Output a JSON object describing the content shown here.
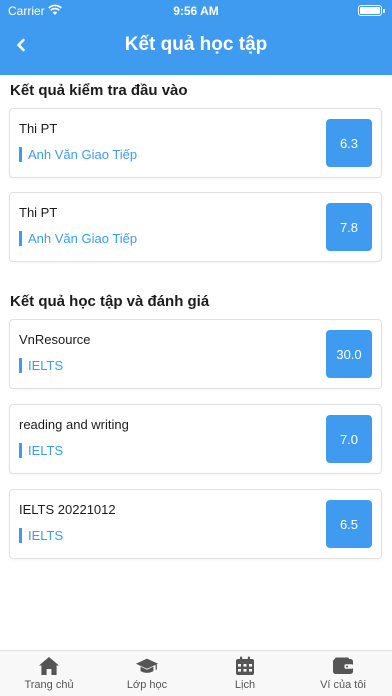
{
  "status_bar": {
    "carrier": "Carrier",
    "time": "9:56 AM"
  },
  "nav": {
    "title": "Kết quả học tập"
  },
  "entrance": {
    "title": "Kết quả kiểm tra đầu vào",
    "items": [
      {
        "title": "Thi PT",
        "subject": "Anh Văn Giao Tiếp",
        "score": "6.3"
      },
      {
        "title": "Thi PT",
        "subject": "Anh Văn Giao Tiếp",
        "score": "7.8"
      }
    ]
  },
  "study": {
    "title": "Kết quả học tập và đánh giá",
    "items": [
      {
        "title": "VnResource",
        "subject": "IELTS",
        "score": "30.0"
      },
      {
        "title": "reading and writing",
        "subject": "IELTS",
        "score": "7.0"
      },
      {
        "title": "IELTS 20221012",
        "subject": "IELTS",
        "score": "6.5"
      }
    ]
  },
  "tabs": [
    {
      "label": "Trang chủ",
      "icon": "home-icon"
    },
    {
      "label": "Lớp học",
      "icon": "graduation-cap-icon"
    },
    {
      "label": "Lịch",
      "icon": "calendar-icon"
    },
    {
      "label": "Ví của tôi",
      "icon": "wallet-icon"
    }
  ],
  "colors": {
    "primary": "#3f9bf0",
    "text": "#1c1c1c"
  }
}
